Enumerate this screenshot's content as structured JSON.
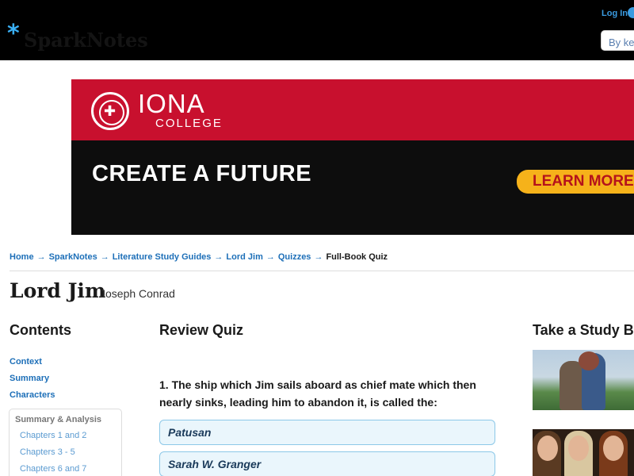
{
  "header": {
    "logo_text": "SparkNotes",
    "login_label": "Log In",
    "search_placeholder": "By keyword"
  },
  "ad": {
    "brand": "IONA",
    "brand_sub": "COLLEGE",
    "headline": "CREATE A FUTURE",
    "cta_label": "LEARN MORE",
    "colors": {
      "top": "#c8102e",
      "bottom": "#0d0d0d",
      "cta": "#f6b21a"
    }
  },
  "breadcrumb": {
    "items": [
      "Home",
      "SparkNotes",
      "Literature Study Guides",
      "Lord Jim",
      "Quizzes"
    ],
    "current": "Full-Book Quiz",
    "separator": "→"
  },
  "book": {
    "title": "Lord Jim",
    "author": "Joseph Conrad"
  },
  "contents": {
    "heading": "Contents",
    "links": [
      "Context",
      "Summary",
      "Characters"
    ],
    "section_title": "Summary & Analysis",
    "section_items": [
      "Chapters 1 and 2",
      "Chapters 3 - 5",
      "Chapters 6 and 7"
    ]
  },
  "quiz": {
    "heading": "Review Quiz",
    "question": "1. The ship which Jim sails aboard as chief mate which then nearly sinks, leading him to abandon it, is called the:",
    "answers": [
      "Patusan",
      "Sarah W. Granger"
    ]
  },
  "study_break": {
    "heading": "Take a Study Break"
  }
}
